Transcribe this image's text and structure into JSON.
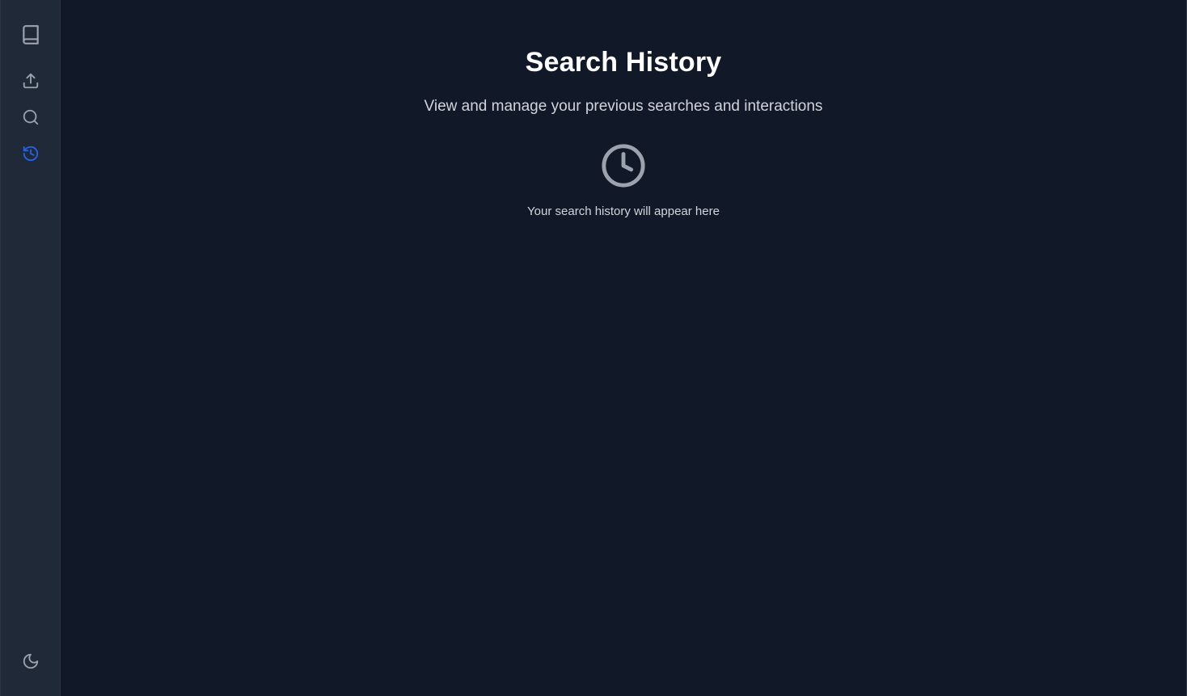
{
  "sidebar": {
    "items": [
      {
        "name": "library",
        "icon": "book-icon"
      },
      {
        "name": "upload",
        "icon": "upload-icon"
      },
      {
        "name": "search",
        "icon": "search-icon"
      },
      {
        "name": "history",
        "icon": "history-icon",
        "active": true
      }
    ],
    "footer": {
      "icon": "moon-icon"
    }
  },
  "main": {
    "title": "Search History",
    "subtitle": "View and manage your previous searches and interactions",
    "empty_state": {
      "icon": "clock-icon",
      "text": "Your search history will appear here"
    }
  },
  "colors": {
    "background": "#111827",
    "sidebar": "#1f2937",
    "accent": "#2563eb",
    "icon": "#9ca3af"
  }
}
